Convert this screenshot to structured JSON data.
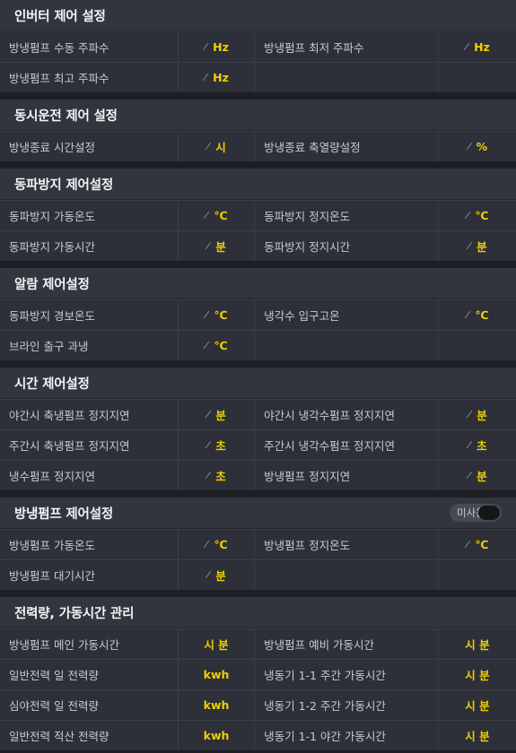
{
  "sections": [
    {
      "title": "인버터 제어 설정",
      "rows": [
        [
          {
            "label": "방냉펌프 수동 주파수",
            "unit": "Hz",
            "edit": true
          },
          {
            "label": "방냉펌프 최저 주파수",
            "unit": "Hz",
            "edit": true
          }
        ],
        [
          {
            "label": "방냉펌프 최고 주파수",
            "unit": "Hz",
            "edit": true
          },
          null
        ]
      ]
    },
    {
      "title": "동시운전 제어 설정",
      "rows": [
        [
          {
            "label": "방냉종료 시간설정",
            "unit": "시",
            "edit": true
          },
          {
            "label": "방냉종료 축열량설정",
            "unit": "%",
            "edit": true
          }
        ]
      ]
    },
    {
      "title": "동파방지 제어설정",
      "rows": [
        [
          {
            "label": "동파방지 가동온도",
            "unit": "℃",
            "edit": true
          },
          {
            "label": "동파방지 정지온도",
            "unit": "℃",
            "edit": true
          }
        ],
        [
          {
            "label": "동파방지 가동시간",
            "unit": "분",
            "edit": true
          },
          {
            "label": "동파방지 정지시간",
            "unit": "분",
            "edit": true
          }
        ]
      ]
    },
    {
      "title": "알람 제어설정",
      "rows": [
        [
          {
            "label": "동파방지 경보온도",
            "unit": "℃",
            "edit": true
          },
          {
            "label": "냉각수 입구고온",
            "unit": "℃",
            "edit": true
          }
        ],
        [
          {
            "label": "브라인 출구 과냉",
            "unit": "℃",
            "edit": true
          },
          null
        ]
      ]
    },
    {
      "title": "시간 제어설정",
      "rows": [
        [
          {
            "label": "야간시 축냉펌프 정지지연",
            "unit": "분",
            "edit": true
          },
          {
            "label": "야간시 냉각수펌프 정지지연",
            "unit": "분",
            "edit": true
          }
        ],
        [
          {
            "label": "주간시 축냉펌프 정지지연",
            "unit": "초",
            "edit": true
          },
          {
            "label": "주간시 냉각수펌프 정지지연",
            "unit": "초",
            "edit": true
          }
        ],
        [
          {
            "label": "냉수펌프 정지지연",
            "unit": "초",
            "edit": true
          },
          {
            "label": "방냉펌프 정지지연",
            "unit": "분",
            "edit": true
          }
        ]
      ]
    },
    {
      "title": "방냉펌프 제어설정",
      "toggle": {
        "label": "미사용"
      },
      "rows": [
        [
          {
            "label": "방냉펌프 가동온도",
            "unit": "℃",
            "edit": true
          },
          {
            "label": "방냉펌프 정지온도",
            "unit": "℃",
            "edit": true
          }
        ],
        [
          {
            "label": "방냉펌프 대기시간",
            "unit": "분",
            "edit": true
          },
          null
        ]
      ]
    },
    {
      "title": "전력량, 가동시간 관리",
      "rows": [
        [
          {
            "label": "방냉펌프 메인 가동시간",
            "unit": "시 분",
            "edit": false
          },
          {
            "label": "방냉펌프 예비 가동시간",
            "unit": "시 분",
            "edit": false
          }
        ],
        [
          {
            "label": "일반전력 일 전력량",
            "unit": "kwh",
            "edit": false
          },
          {
            "label": "냉동기 1-1 주간 가동시간",
            "unit": "시 분",
            "edit": false
          }
        ],
        [
          {
            "label": "심야전력 일 전력량",
            "unit": "kwh",
            "edit": false
          },
          {
            "label": "냉동기 1-2 주간 가동시간",
            "unit": "시 분",
            "edit": false
          }
        ],
        [
          {
            "label": "일반전력 적산 전력량",
            "unit": "kwh",
            "edit": false
          },
          {
            "label": "냉동기 1-1 야간 가동시간",
            "unit": "시 분",
            "edit": false
          }
        ]
      ]
    }
  ]
}
